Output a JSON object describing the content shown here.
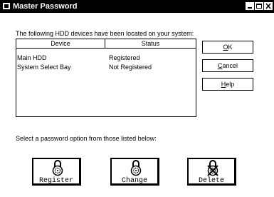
{
  "window": {
    "title": "Master Password"
  },
  "intro_text": "The following HDD devices have been located on your system:",
  "device_list": {
    "headers": [
      "Device",
      "Status"
    ],
    "rows": [
      {
        "device": "Main HDD",
        "status": "Registered"
      },
      {
        "device": "System Select Bay",
        "status": "Not Registered"
      }
    ]
  },
  "buttons": {
    "ok": {
      "mnemonic": "O",
      "rest": "K"
    },
    "cancel": {
      "mnemonic": "C",
      "rest": "ancel"
    },
    "help": {
      "mnemonic": "H",
      "rest": "elp"
    }
  },
  "select_text": "Select a password option from those listed below:",
  "options": [
    {
      "label": "Register",
      "icon": "lock-icon"
    },
    {
      "label": "Change",
      "icon": "lock-icon"
    },
    {
      "label": "Delete",
      "icon": "lock-delete-icon"
    }
  ]
}
